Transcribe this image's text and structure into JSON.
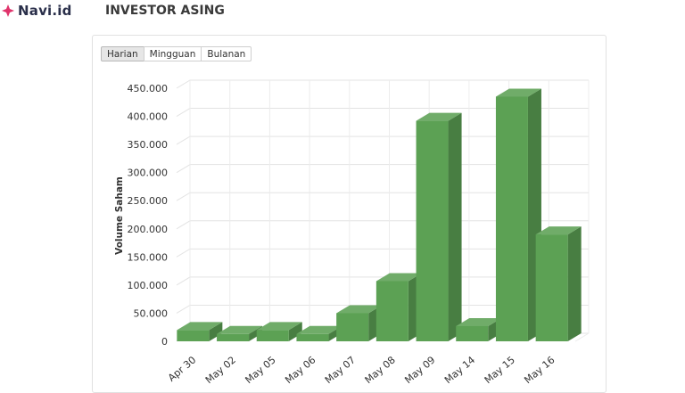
{
  "header": {
    "brand": "Navi.id",
    "title": "INVESTOR ASING"
  },
  "tabs": [
    {
      "label": "Harian",
      "active": true
    },
    {
      "label": "Mingguan",
      "active": false
    },
    {
      "label": "Bulanan",
      "active": false
    }
  ],
  "colors": {
    "brand_accent": "#e0336b",
    "bar": "#5ca154"
  },
  "chart_data": {
    "type": "bar",
    "style": "3d-column",
    "categories": [
      "Apr 30",
      "May 02",
      "May 05",
      "May 06",
      "May 07",
      "May 08",
      "May 09",
      "May 14",
      "May 15",
      "May 16"
    ],
    "values": [
      20000,
      13000,
      20000,
      13000,
      50000,
      107000,
      392000,
      27000,
      435000,
      190000
    ],
    "ylabel": "Volume Saham",
    "ylim": [
      0,
      450000
    ],
    "yticks": [
      0,
      50000,
      100000,
      150000,
      200000,
      250000,
      300000,
      350000,
      400000,
      450000
    ],
    "ytick_labels": [
      "0",
      "50.000",
      "100.000",
      "150.000",
      "200.000",
      "250.000",
      "300.000",
      "350.000",
      "400.000",
      "450.000"
    ],
    "grid": true,
    "legend": "none"
  }
}
